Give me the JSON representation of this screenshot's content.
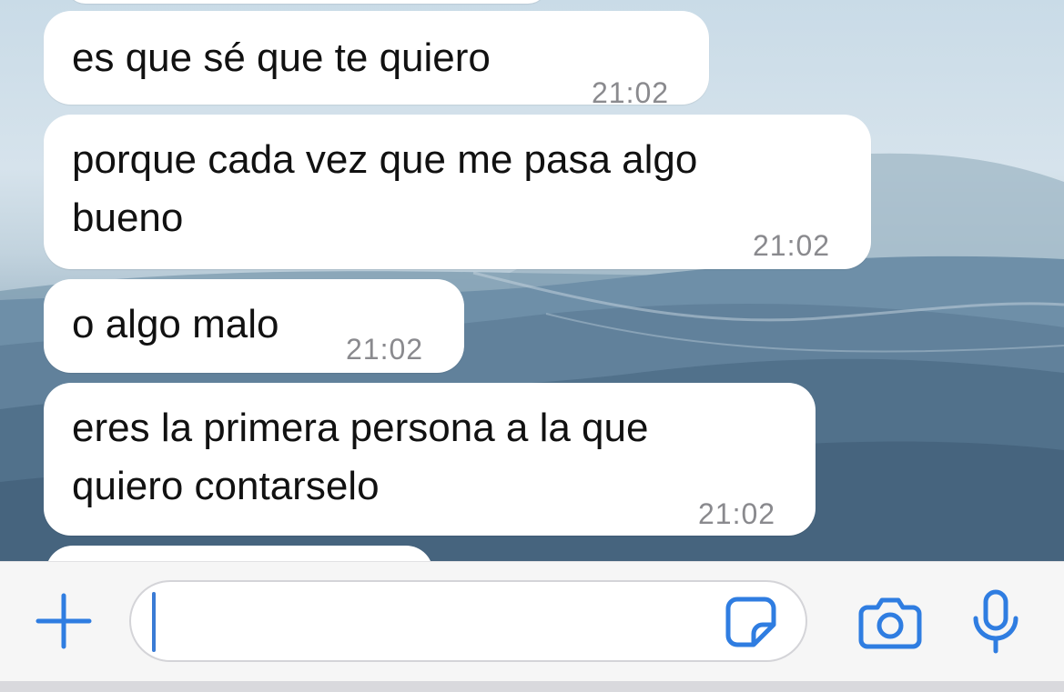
{
  "colors": {
    "accent": "#2f7de1",
    "bubble": "#ffffff",
    "time_text": "#8a8a8e",
    "input_bar": "#f6f6f6"
  },
  "messages": [
    {
      "text": "es que sé que te quiero",
      "time": "21:02"
    },
    {
      "text": "porque cada vez que me pasa algo\nbueno",
      "time": "21:02"
    },
    {
      "text": "o algo malo",
      "time": "21:02"
    },
    {
      "text": "eres la primera persona a la que\nquiero contarselo",
      "time": "21:02"
    }
  ],
  "input": {
    "value": "",
    "placeholder": ""
  },
  "icons": {
    "attach": "plus-icon",
    "sticker": "sticker-icon",
    "camera": "camera-icon",
    "microphone": "microphone-icon"
  }
}
